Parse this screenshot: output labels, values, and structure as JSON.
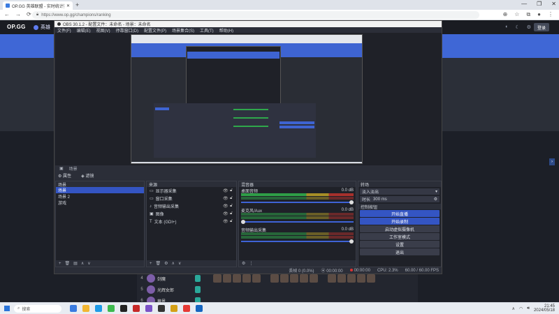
{
  "browser": {
    "tab_title": "OP.GG 英雄联盟 - 实时统计数据",
    "new_tab": "+",
    "url": "https://www.op.gg/champions/ranking",
    "window_controls": [
      "—",
      "❐",
      "✕"
    ]
  },
  "site": {
    "logo": "OP.GG",
    "brand": "英雄",
    "login": "登录",
    "rows": [
      {
        "rank": "4",
        "name": "剑魔"
      },
      {
        "rank": "5",
        "name": "光辉女郎"
      },
      {
        "rank": "6",
        "name": "薇恩"
      }
    ]
  },
  "obs": {
    "title": "OBS 30.1.2 - 配置文件：未命名 - 场景：未命名",
    "menu": [
      "文件(F)",
      "编辑(E)",
      "视图(V)",
      "停靠窗口(D)",
      "配置文件(P)",
      "场景集合(S)",
      "工具(T)",
      "帮助(H)"
    ],
    "scene_bar_label": "场景",
    "toolbar": [
      "属性",
      "滤镜"
    ],
    "docks": {
      "scenes_title": "场景",
      "sources_title": "来源",
      "mixer_title": "混音器",
      "controls_title": "控制按钮"
    },
    "scenes": [
      "场景",
      "场景 2",
      "游戏"
    ],
    "sources": [
      "显示器采集",
      "窗口采集",
      "音频输出采集",
      "图像",
      "文本 (GDI+)"
    ],
    "mixer": [
      {
        "name": "桌面音频",
        "level": "0.0 dB"
      },
      {
        "name": "麦克风/Aux",
        "level": "0.0 dB"
      },
      {
        "name": "音频输出采集",
        "level": "0.0 dB"
      }
    ],
    "transition": {
      "type": "淡入淡出",
      "duration_label": "时长",
      "duration": "300 ms"
    },
    "controls": [
      "开始直播",
      "开始录制",
      "启动虚拟摄像机",
      "工作室模式",
      "设置",
      "退出"
    ],
    "status": {
      "frames": "丢帧 0 (0.0%)",
      "live": "00:00:00",
      "rec": "00:00:00",
      "cpu": "CPU: 2.3%",
      "fps": "60.00 / 60.00 FPS"
    }
  },
  "taskbar": {
    "search": "搜索",
    "time": "21:45",
    "date": "2024/05/18"
  },
  "colors": {
    "accent": "#3455c3",
    "site_banner": "#3f67d6",
    "meter_green": "#2e9e47",
    "meter_red": "#a8302c"
  }
}
